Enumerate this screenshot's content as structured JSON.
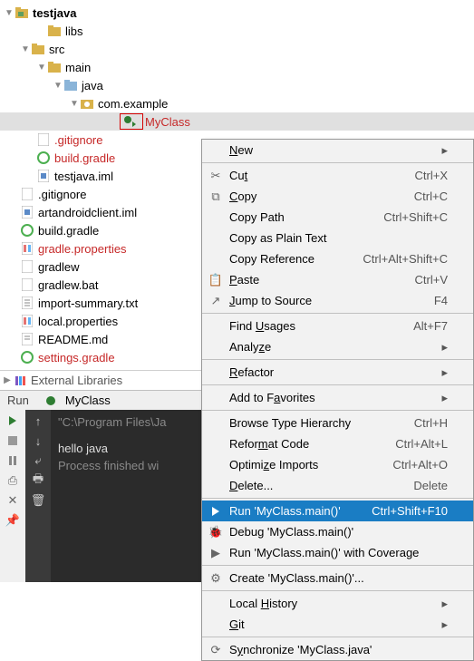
{
  "tree": {
    "root": "testjava",
    "n_libs": "libs",
    "n_src": "src",
    "n_main": "main",
    "n_java": "java",
    "n_pkg": "com.example",
    "n_myclass": "MyClass",
    "n_gitignore1": ".gitignore",
    "n_buildgradle1": "build.gradle",
    "n_iml1": "testjava.iml",
    "n_gitignore2": ".gitignore",
    "n_artiml": "artandroidclient.iml",
    "n_buildgradle2": "build.gradle",
    "n_gradleprop": "gradle.properties",
    "n_gradlew": "gradlew",
    "n_gradlewbat": "gradlew.bat",
    "n_importsum": "import-summary.txt",
    "n_localprop": "local.properties",
    "n_readme": "README.md",
    "n_settings": "settings.gradle"
  },
  "extlibs": "External Libraries",
  "runbar": {
    "run": "Run",
    "tab": "MyClass"
  },
  "console": {
    "path": "\"C:\\Program Files\\Ja",
    "hello": "hello java",
    "exit": "Process finished wi"
  },
  "menu": {
    "new": "New",
    "cut": "Cut",
    "cut_sc": "Ctrl+X",
    "copy": "Copy",
    "copy_sc": "Ctrl+C",
    "copypath": "Copy Path",
    "copypath_sc": "Ctrl+Shift+C",
    "copyplain": "Copy as Plain Text",
    "copyref": "Copy Reference",
    "copyref_sc": "Ctrl+Alt+Shift+C",
    "paste": "Paste",
    "paste_sc": "Ctrl+V",
    "jump": "Jump to Source",
    "jump_sc": "F4",
    "findusages": "Find Usages",
    "findusages_sc": "Alt+F7",
    "analyze": "Analyze",
    "refactor": "Refactor",
    "addfav": "Add to Favorites",
    "browse": "Browse Type Hierarchy",
    "browse_sc": "Ctrl+H",
    "reformat": "Reformat Code",
    "reformat_sc": "Ctrl+Alt+L",
    "optimize": "Optimize Imports",
    "optimize_sc": "Ctrl+Alt+O",
    "delete": "Delete...",
    "delete_sc": "Delete",
    "run": "Run 'MyClass.main()'",
    "run_sc": "Ctrl+Shift+F10",
    "debug": "Debug 'MyClass.main()'",
    "coverage": "Run 'MyClass.main()' with Coverage",
    "create": "Create 'MyClass.main()'...",
    "history": "Local History",
    "git": "Git",
    "sync": "Synchronize 'MyClass.java'"
  }
}
